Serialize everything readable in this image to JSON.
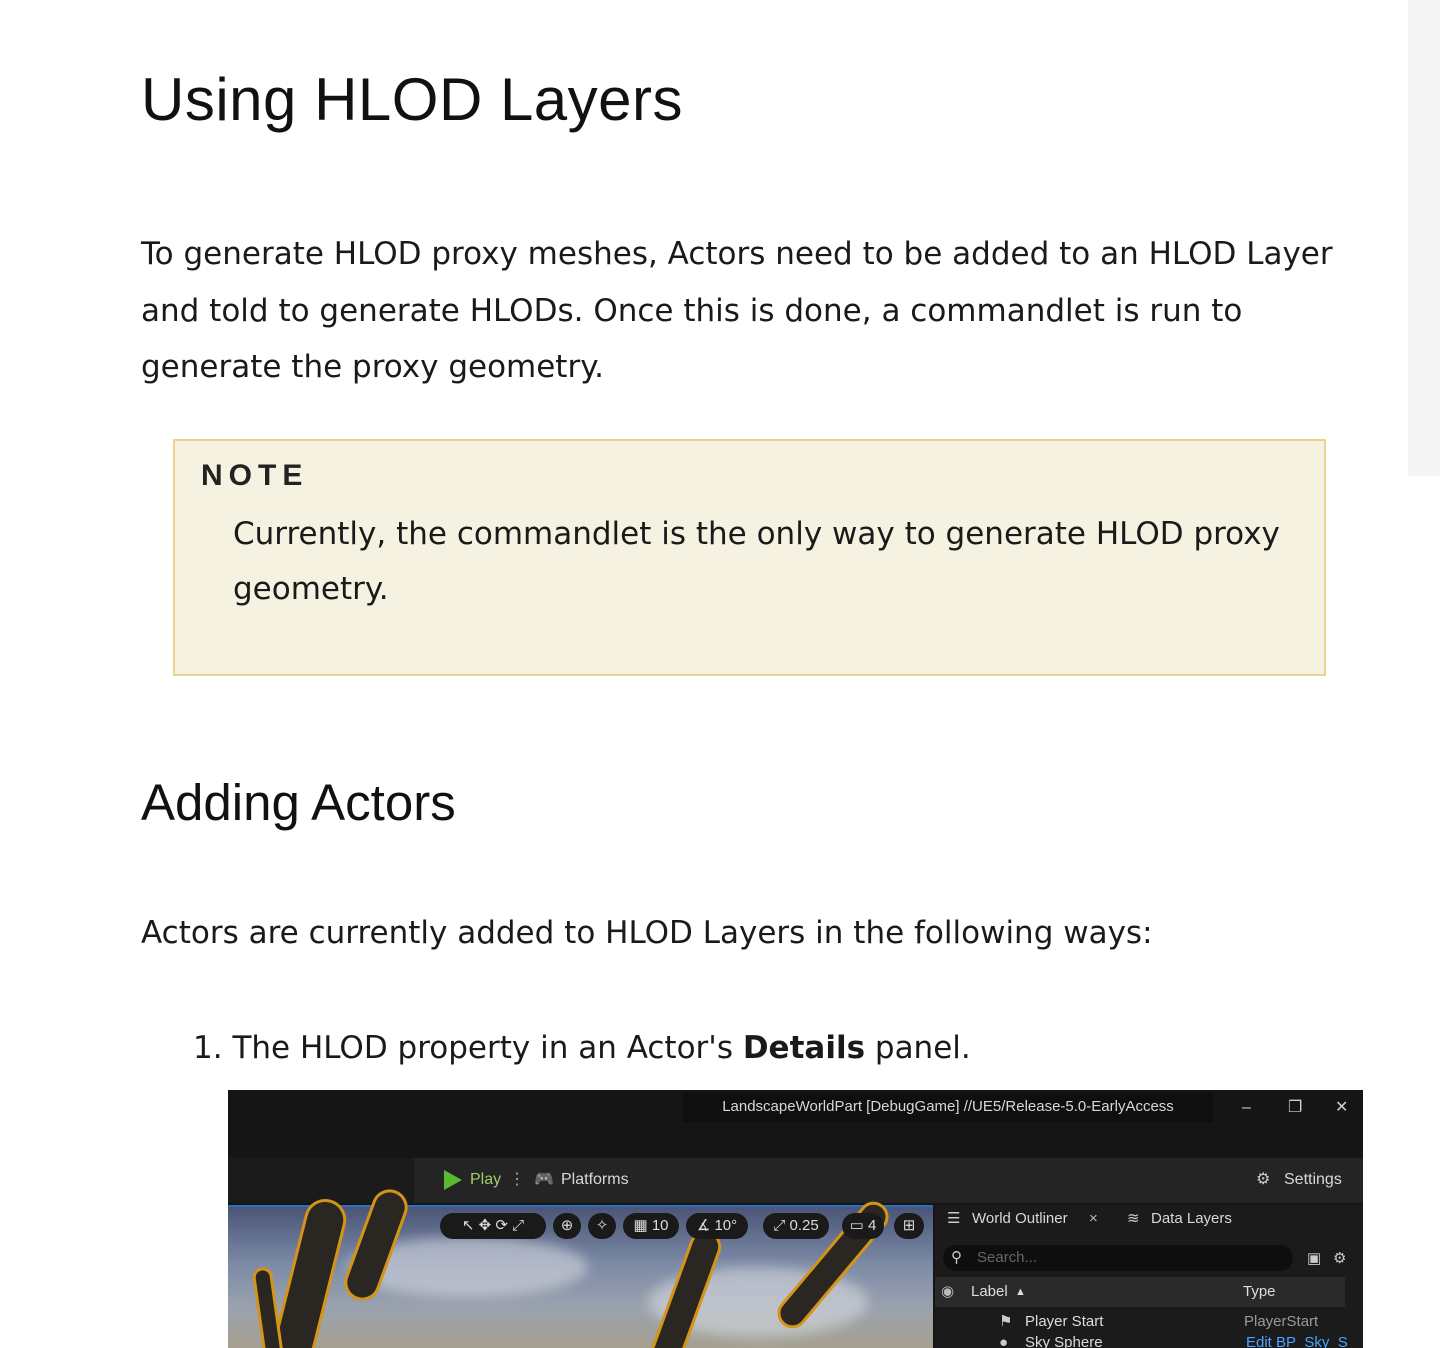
{
  "page": {
    "title": "Using HLOD Layers",
    "intro": "To generate HLOD proxy meshes, Actors need to be added to an HLOD Layer and told to generate HLODs. Once this is done, a commandlet is run to generate the proxy geometry.",
    "note": {
      "label": "NOTE",
      "text": "Currently, the commandlet is the only way to generate HLOD proxy geometry."
    },
    "section_title": "Adding Actors",
    "section_intro": "Actors are currently added to HLOD Layers in the following ways:",
    "list": [
      {
        "number": "1.",
        "text_before": "The HLOD property in an Actor's ",
        "bold": "Details",
        "text_after": " panel."
      }
    ]
  },
  "editor": {
    "window_title": "LandscapeWorldPart [DebugGame] //UE5/Release-5.0-EarlyAccess",
    "window_controls": [
      "–",
      "❐",
      "✕"
    ],
    "toolbar": {
      "play": "Play",
      "platforms": "Platforms",
      "settings": "Settings"
    },
    "viewport_controls": {
      "grid_snap": "10",
      "rotation_snap": "10°",
      "scale_snap": "0.25",
      "camera_speed": "4"
    },
    "outliner": {
      "tab_world": "World Outliner",
      "tab_close": "×",
      "tab_layers": "Data Layers",
      "search_placeholder": "Search...",
      "col_label": "Label",
      "col_type": "Type",
      "rows": [
        {
          "label": "Player Start",
          "type": "PlayerStart"
        },
        {
          "label": "Sky Sphere",
          "type": "Edit BP_Sky_S"
        }
      ]
    },
    "colors": {
      "play_green": "#5cb82e",
      "selection_outline": "#d49418",
      "link_blue": "#4aa3ff"
    }
  }
}
